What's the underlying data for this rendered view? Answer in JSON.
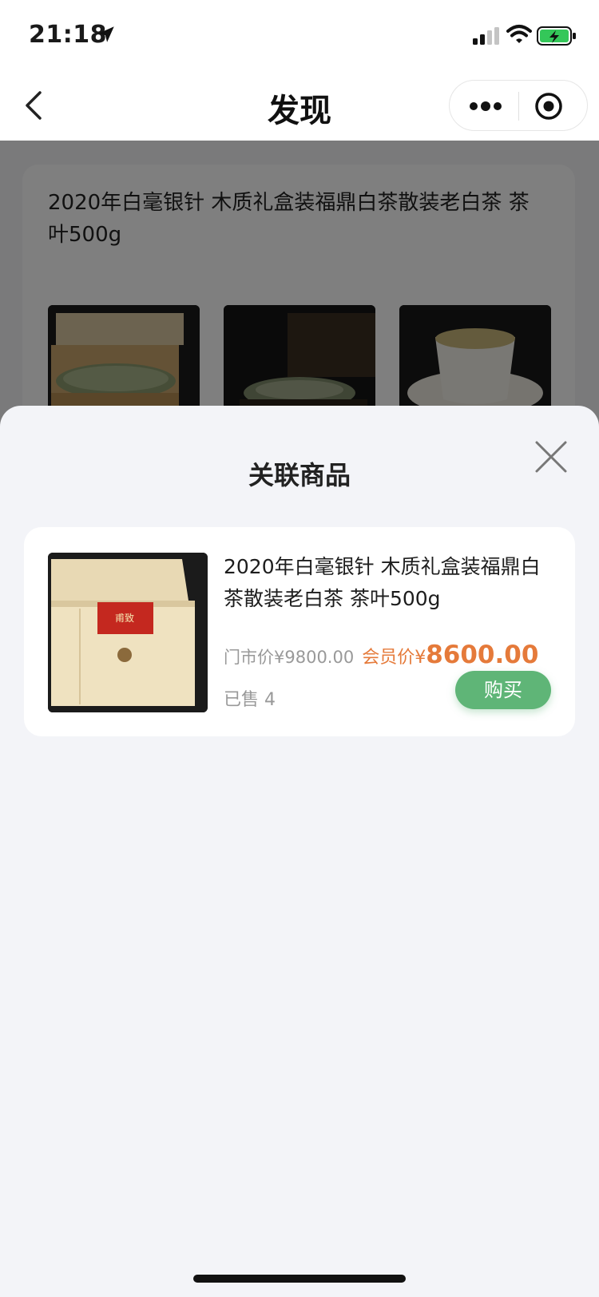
{
  "status_bar": {
    "time": "21:18"
  },
  "nav": {
    "title": "发现"
  },
  "post": {
    "title": "2020年白毫银针 木质礼盒装福鼎白茶散装老白茶 茶叶500g"
  },
  "sheet": {
    "title": "关联商品",
    "product": {
      "title": "2020年白毫银针 木质礼盒装福鼎白茶散装老白茶 茶叶500g",
      "market_label": "门市价",
      "market_price": "¥9800.00",
      "member_label": "会员价",
      "member_currency": "¥",
      "member_price": "8600.00",
      "sold_text": "已售 4",
      "buy_label": "购买",
      "box_seal_text": "甫致"
    }
  },
  "colors": {
    "accent_green": "#5fb577",
    "price_orange": "#e57a3a",
    "sheet_bg": "#f3f4f8",
    "battery_green": "#34c759"
  },
  "icons": [
    "location-arrow-icon",
    "signal-icon",
    "wifi-icon",
    "battery-charging-icon",
    "back-chevron-icon",
    "more-dots-icon",
    "target-close-icon",
    "close-x-icon"
  ]
}
